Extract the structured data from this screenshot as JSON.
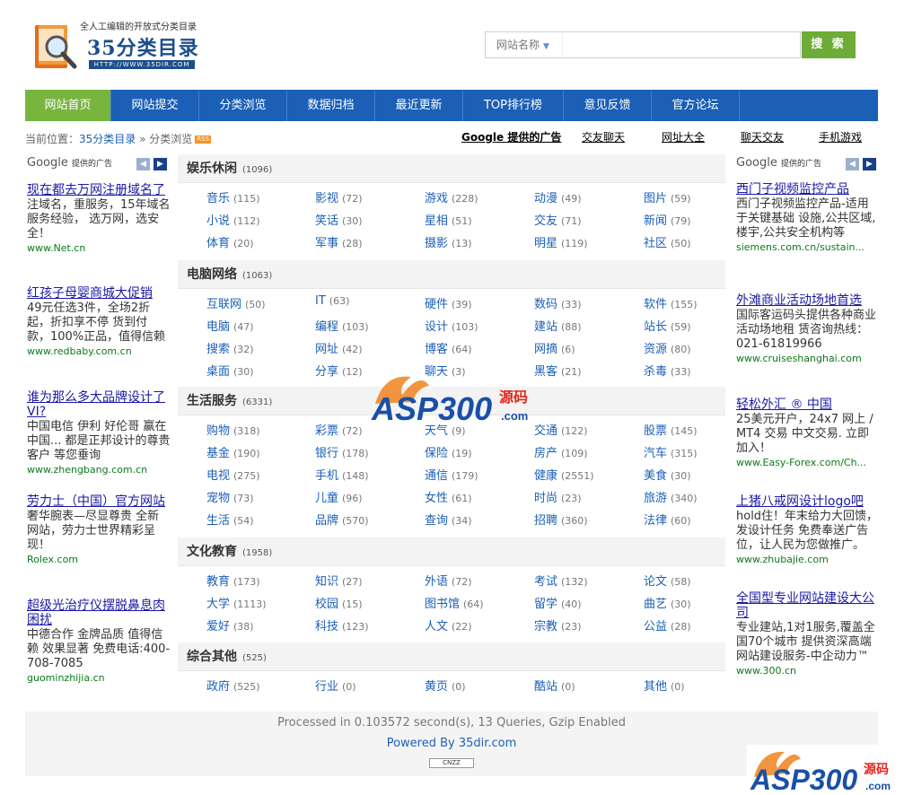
{
  "header": {
    "tagline": "全人工编辑的开放式分类目录",
    "brand": "35分类目录",
    "brand_url": "HTTP://WWW.35DIR.COM",
    "search_select": "网站名称",
    "search_button": "搜 索"
  },
  "nav": [
    "网站首页",
    "网站提交",
    "分类浏览",
    "数据归档",
    "最近更新",
    "TOP排行榜",
    "意见反馈",
    "官方论坛"
  ],
  "breadcrumb": {
    "prefix": "当前位置：",
    "home": "35分类目录",
    "sep": " » ",
    "current": "分类浏览",
    "rss": "RSS"
  },
  "top_links": [
    "Google 提供的广告",
    "交友聊天",
    "网址大全",
    "聊天交友",
    "手机游戏"
  ],
  "ads_label": "Google",
  "ads_label_small": "提供的广告",
  "left_ads": [
    {
      "title": "现在都去万网注册域名了",
      "desc": "注域名，重服务，15年域名服务经验， 选万网，选安全！",
      "url": "www.Net.cn"
    },
    {
      "title": "红孩子母婴商城大促销",
      "desc": "49元任选3件，全场2折起，折扣享不停 货到付款，100%正品，值得信赖",
      "url": "www.redbaby.com.cn"
    },
    {
      "title": "谁为那么多大品牌设计了VI?",
      "desc": "中国电信 伊利 好伦哥 赢在中国... 都是正邦设计的尊贵客户 等您垂询",
      "url": "www.zhengbang.com.cn"
    },
    {
      "title": "劳力士（中国）官方网站",
      "desc": "奢华腕表—尽显尊贵 全新网站，劳力士世界精彩呈现！",
      "url": "Rolex.com"
    },
    {
      "title": "超级光治疗仪摆脱鼻息肉困扰",
      "desc": "中德合作 金牌品质 值得信赖 效果显著 免费电话:400-708-7085",
      "url": "guominzhijia.cn"
    }
  ],
  "right_ads": [
    {
      "title": "西门子视频监控产品",
      "desc": "西门子视频监控产品-适用于关键基础 设施,公共区域,楼宇,公共安全机构等",
      "url": "siemens.com.cn/sustain..."
    },
    {
      "title": "外滩商业活动场地首选",
      "desc": "国际客运码头提供各种商业活动场地租 赁咨询热线：021-61819966",
      "url": "www.cruiseshanghai.com"
    },
    {
      "title": "轻松外汇 ® 中国",
      "desc": "25美元开户，24x7 网上 / MT4 交易 中文交易. 立即加入！",
      "url": "www.Easy-Forex.com/Ch..."
    },
    {
      "title": "上猪八戒网设计logo吧",
      "desc": "hold住！年末给力大回馈，发设计任务 免费奉送广告位，让人民为您做推广。",
      "url": "www.zhubajie.com"
    },
    {
      "title": "全国型专业网站建设大公司",
      "desc": "专业建站,1对1服务,覆盖全国70个城市 提供资深高端网站建设服务-中企动力™",
      "url": "www.300.cn"
    }
  ],
  "categories": [
    {
      "name": "娱乐休闲",
      "count": "(1096)",
      "items": [
        {
          "n": "音乐",
          "c": "(115)"
        },
        {
          "n": "影视",
          "c": "(72)"
        },
        {
          "n": "游戏",
          "c": "(228)"
        },
        {
          "n": "动漫",
          "c": "(49)"
        },
        {
          "n": "图片",
          "c": "(59)"
        },
        {
          "n": "小说",
          "c": "(112)"
        },
        {
          "n": "笑话",
          "c": "(30)"
        },
        {
          "n": "星相",
          "c": "(51)"
        },
        {
          "n": "交友",
          "c": "(71)"
        },
        {
          "n": "新闻",
          "c": "(79)"
        },
        {
          "n": "体育",
          "c": "(20)"
        },
        {
          "n": "军事",
          "c": "(28)"
        },
        {
          "n": "摄影",
          "c": "(13)"
        },
        {
          "n": "明星",
          "c": "(119)"
        },
        {
          "n": "社区",
          "c": "(50)"
        }
      ]
    },
    {
      "name": "电脑网络",
      "count": "(1063)",
      "items": [
        {
          "n": "互联网",
          "c": "(50)"
        },
        {
          "n": "IT",
          "c": "(63)"
        },
        {
          "n": "硬件",
          "c": "(39)"
        },
        {
          "n": "数码",
          "c": "(33)"
        },
        {
          "n": "软件",
          "c": "(155)"
        },
        {
          "n": "电脑",
          "c": "(47)"
        },
        {
          "n": "编程",
          "c": "(103)"
        },
        {
          "n": "设计",
          "c": "(103)"
        },
        {
          "n": "建站",
          "c": "(88)"
        },
        {
          "n": "站长",
          "c": "(59)"
        },
        {
          "n": "搜索",
          "c": "(32)"
        },
        {
          "n": "网址",
          "c": "(42)"
        },
        {
          "n": "博客",
          "c": "(64)"
        },
        {
          "n": "网摘",
          "c": "(6)"
        },
        {
          "n": "资源",
          "c": "(80)"
        },
        {
          "n": "桌面",
          "c": "(30)"
        },
        {
          "n": "分享",
          "c": "(12)"
        },
        {
          "n": "聊天",
          "c": "(3)"
        },
        {
          "n": "黑客",
          "c": "(21)"
        },
        {
          "n": "杀毒",
          "c": "(33)"
        }
      ]
    },
    {
      "name": "生活服务",
      "count": "(6331)",
      "items": [
        {
          "n": "购物",
          "c": "(318)"
        },
        {
          "n": "彩票",
          "c": "(72)"
        },
        {
          "n": "天气",
          "c": "(9)"
        },
        {
          "n": "交通",
          "c": "(122)"
        },
        {
          "n": "股票",
          "c": "(145)"
        },
        {
          "n": "基金",
          "c": "(190)"
        },
        {
          "n": "银行",
          "c": "(178)"
        },
        {
          "n": "保险",
          "c": "(19)"
        },
        {
          "n": "房产",
          "c": "(109)"
        },
        {
          "n": "汽车",
          "c": "(315)"
        },
        {
          "n": "电视",
          "c": "(275)"
        },
        {
          "n": "手机",
          "c": "(148)"
        },
        {
          "n": "通信",
          "c": "(179)"
        },
        {
          "n": "健康",
          "c": "(2551)"
        },
        {
          "n": "美食",
          "c": "(30)"
        },
        {
          "n": "宠物",
          "c": "(73)"
        },
        {
          "n": "儿童",
          "c": "(96)"
        },
        {
          "n": "女性",
          "c": "(61)"
        },
        {
          "n": "时尚",
          "c": "(23)"
        },
        {
          "n": "旅游",
          "c": "(340)"
        },
        {
          "n": "生活",
          "c": "(54)"
        },
        {
          "n": "品牌",
          "c": "(570)"
        },
        {
          "n": "查询",
          "c": "(34)"
        },
        {
          "n": "招聘",
          "c": "(360)"
        },
        {
          "n": "法律",
          "c": "(60)"
        }
      ]
    },
    {
      "name": "文化教育",
      "count": "(1958)",
      "items": [
        {
          "n": "教育",
          "c": "(173)"
        },
        {
          "n": "知识",
          "c": "(27)"
        },
        {
          "n": "外语",
          "c": "(72)"
        },
        {
          "n": "考试",
          "c": "(132)"
        },
        {
          "n": "论文",
          "c": "(58)"
        },
        {
          "n": "大学",
          "c": "(1113)"
        },
        {
          "n": "校园",
          "c": "(15)"
        },
        {
          "n": "图书馆",
          "c": "(64)"
        },
        {
          "n": "留学",
          "c": "(40)"
        },
        {
          "n": "曲艺",
          "c": "(30)"
        },
        {
          "n": "爱好",
          "c": "(38)"
        },
        {
          "n": "科技",
          "c": "(123)"
        },
        {
          "n": "人文",
          "c": "(22)"
        },
        {
          "n": "宗教",
          "c": "(23)"
        },
        {
          "n": "公益",
          "c": "(28)"
        }
      ]
    },
    {
      "name": "综合其他",
      "count": "(525)",
      "items": [
        {
          "n": "政府",
          "c": "(525)"
        },
        {
          "n": "行业",
          "c": "(0)"
        },
        {
          "n": "黄页",
          "c": "(0)"
        },
        {
          "n": "酷站",
          "c": "(0)"
        },
        {
          "n": "其他",
          "c": "(0)"
        }
      ]
    }
  ],
  "watermark": {
    "text": "ASP300",
    "sub": "源码",
    "dom": ".com"
  },
  "footer": {
    "processed": "Processed in 0.103572 second(s), 13 Queries, Gzip Enabled",
    "powered": "Powered By 35dir.com",
    "badge": "CNZZ"
  },
  "colors": {
    "nav_bg": "#1b5fb6",
    "nav_active": "#78b53f",
    "search_btn": "#6cac37",
    "link": "#1b5fb6",
    "ad_title": "#1a1aa6",
    "ad_url": "#0a7a1a"
  }
}
